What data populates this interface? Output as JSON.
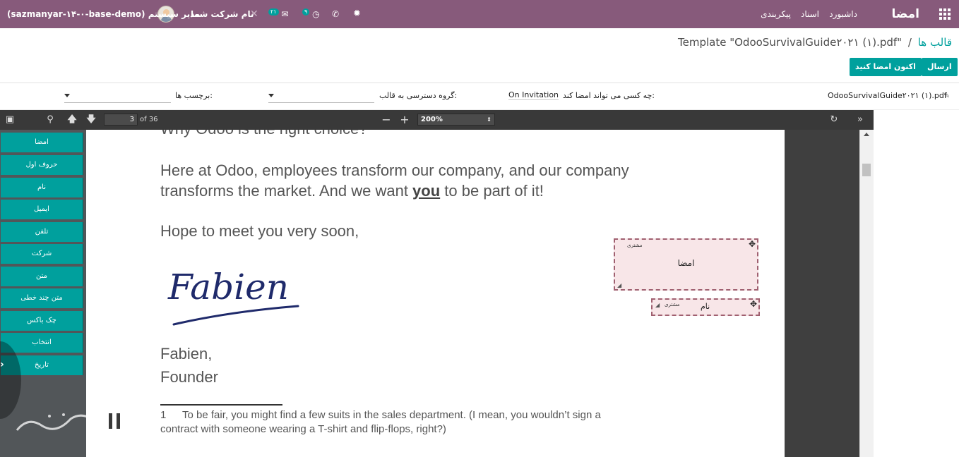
{
  "topbar": {
    "brand": "امضا",
    "menu": [
      "داشبورد",
      "اسناد",
      "پیکربندی"
    ],
    "db_name": "(sazmanyar-۱۴-۰-base-demo)",
    "user_name": "مدیر سیستم",
    "company": "نام شرکت شما",
    "messages_count": "۲۱",
    "activities_count": "۹"
  },
  "breadcrumb": {
    "parent": "قالب ها",
    "separator": "/",
    "current": "Template \"OdooSurvivalGuide۲۰۲۱ (۱).pdf\""
  },
  "buttons": {
    "send": "ارسال",
    "sign_now": "اکنون امضا کنید"
  },
  "fields": {
    "filename": "OdooSurvivalGuide۲۰۲۱ (۱).pdf",
    "who_can_sign_label": "چه کسی می تواند امضا کند:",
    "who_can_sign_value": "On Invitation",
    "access_group_label": "گروه دسترسی به قالب:",
    "tags_label": "برچسب ها:"
  },
  "viewer": {
    "page_number": "3",
    "page_total": "of 36",
    "zoom": "200%"
  },
  "field_types": [
    "امضا",
    "حروف اول",
    "نام",
    "ایمیل",
    "تلفن",
    "شرکت",
    "متن",
    "متن چند خطی",
    "چک باکس",
    "انتخاب",
    "تاریخ"
  ],
  "pdf": {
    "top_line": "Why Odoo is the right choice?",
    "para1_line1": "Here at Odoo, employees transform our company, and our company",
    "para1_line2_a": "transforms the market. And we want ",
    "para1_line2_b": "you",
    "para1_line2_c": " to be part of it!",
    "para2": "Hope to meet you very soon,",
    "sign_name": "Fabien,",
    "sign_title": "Founder",
    "footnote_num": "1",
    "footnote_line1": "To be fair, you might find a few suits in the sales department. (I mean, you wouldn’t sign a",
    "footnote_line2": "contract with someone wearing a T-shirt and flip-flops, right?)",
    "handwritten": "Fabien"
  },
  "sign_items": {
    "signature_role": "مشتری",
    "signature_label": "امضا",
    "name_role": "مشتری",
    "name_label": "نام"
  },
  "colors": {
    "topbar": "#875a7b",
    "accent": "#00a09d",
    "viewer_bg": "#525659"
  }
}
